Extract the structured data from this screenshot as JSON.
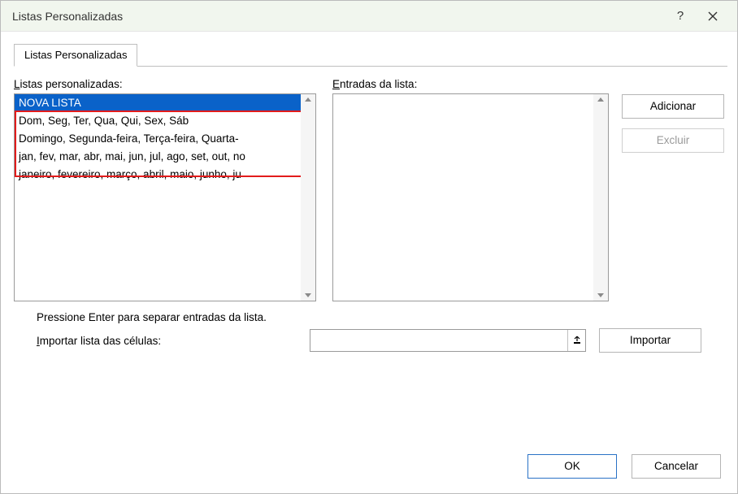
{
  "window": {
    "title": "Listas Personalizadas"
  },
  "tabs": {
    "custom_lists": "Listas Personalizadas"
  },
  "labels": {
    "custom_lists": "Listas personalizadas:",
    "list_entries": "Entradas da lista:",
    "hint": "Pressione Enter para separar entradas da lista.",
    "import_cells": "Importar lista das células:"
  },
  "lists": {
    "items": [
      "NOVA LISTA",
      "Dom, Seg, Ter, Qua, Qui, Sex, Sáb",
      "Domingo, Segunda-feira, Terça-feira, Quarta-",
      "jan, fev, mar, abr, mai, jun, jul, ago, set, out, no",
      "janeiro, fevereiro, março, abril, maio, junho, ju"
    ],
    "selected_index": 0
  },
  "entries": {
    "value": ""
  },
  "import_ref": {
    "value": ""
  },
  "buttons": {
    "add": "Adicionar",
    "delete": "Excluir",
    "import": "Importar",
    "ok": "OK",
    "cancel": "Cancelar"
  }
}
